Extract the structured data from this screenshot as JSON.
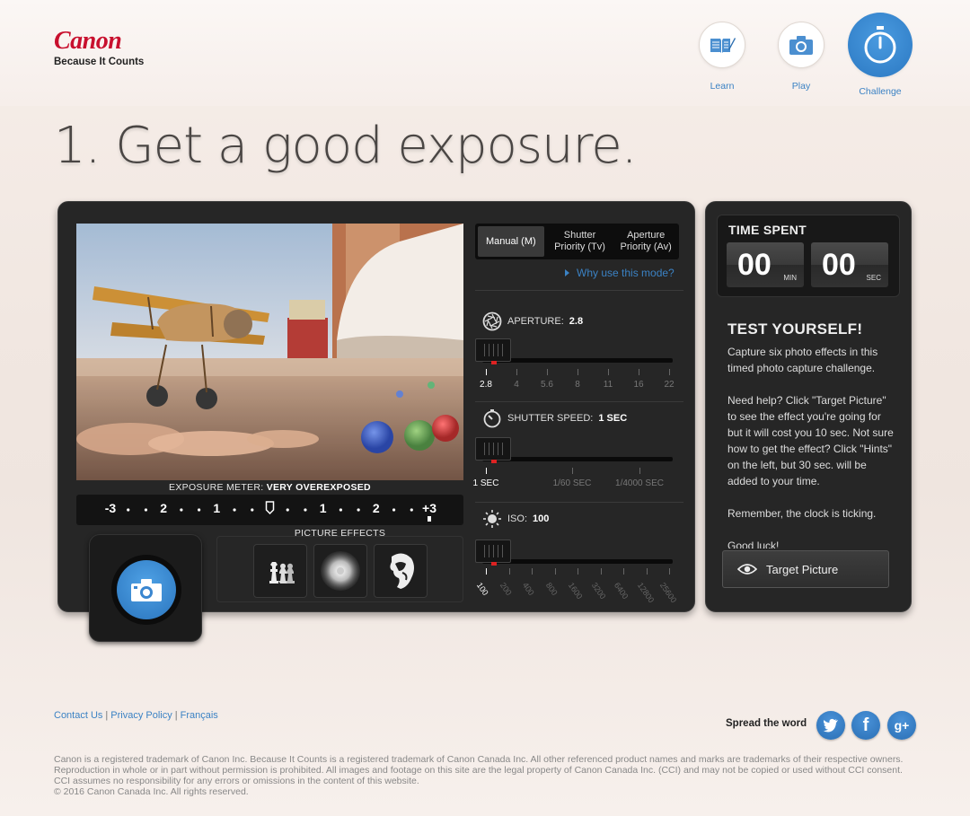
{
  "brand": {
    "name": "Canon",
    "tagline": "Because It Counts"
  },
  "nav": [
    {
      "label": "Learn",
      "icon": "book-pencil-icon"
    },
    {
      "label": "Play",
      "icon": "camera-icon"
    },
    {
      "label": "Challenge",
      "icon": "stopwatch-icon",
      "active": true
    }
  ],
  "page_title": "1. Get a good exposure.",
  "exposure_meter": {
    "label": "EXPOSURE METER: ",
    "value": "VERY OVEREXPOSED",
    "scale": [
      "-3",
      "2",
      "1",
      "0",
      "1",
      "2",
      "+3"
    ]
  },
  "modes": [
    {
      "label": "Manual (M)",
      "active": true
    },
    {
      "label": "Shutter\nPriority (Tv)"
    },
    {
      "label": "Aperture\nPriority (Av)"
    }
  ],
  "why_link": "Why use this mode?",
  "aperture": {
    "label": "APERTURE: ",
    "value": "2.8",
    "ticks": [
      "2.8",
      "4",
      "5.6",
      "8",
      "11",
      "16",
      "22"
    ],
    "selected_index": 0
  },
  "shutter": {
    "label": "SHUTTER SPEED: ",
    "value": "1 SEC",
    "ticks": [
      "1 SEC",
      "1/60 SEC",
      "1/4000 SEC"
    ],
    "selected_index": 0
  },
  "iso": {
    "label": "ISO: ",
    "value": "100",
    "ticks": [
      "100",
      "200",
      "400",
      "800",
      "1600",
      "3200",
      "6400",
      "12800",
      "25600"
    ],
    "selected_index": 0
  },
  "picture_effects": {
    "label": "PICTURE EFFECTS",
    "items": [
      "chess-pieces-icon",
      "blur-disc-icon",
      "face-silhouette-icon"
    ]
  },
  "timer": {
    "title": "TIME SPENT",
    "minutes": "00",
    "min_unit": "MIN",
    "seconds": "00",
    "sec_unit": "SEC"
  },
  "test": {
    "title": "TEST YOURSELF!",
    "text": "Capture six photo effects in this timed photo capture challenge.\n\nNeed help? Click \"Target Picture\" to see the effect you're going for but it will cost you 10 sec. Not sure how to get the effect? Click \"Hints\" on the left, but 30 sec. will be added to your time.\n\nRemember, the clock is ticking.\n\nGood luck!",
    "button": "Target Picture"
  },
  "footer": {
    "links": [
      "Contact Us",
      "Privacy Policy",
      "Français"
    ],
    "spread": "Spread the word",
    "social": [
      "twitter-icon",
      "facebook-icon",
      "googleplus-icon"
    ],
    "legal": "Canon is a registered trademark of Canon Inc. Because It Counts is a registered trademark of Canon Canada Inc. All other referenced product names and marks are trademarks of their respective owners. Reproduction in whole or in part without permission is prohibited. All images and footage on this site are the legal property of Canon Canada Inc. (CCI) and may not be copied or used without CCI consent. CCI assumes no responsibility for any errors or omissions in the content of this website.",
    "copyright": "© 2016 Canon Canada Inc. All rights reserved."
  },
  "colors": {
    "accent": "#3b82c4",
    "brand_red": "#c8102e",
    "panel": "#262626"
  }
}
